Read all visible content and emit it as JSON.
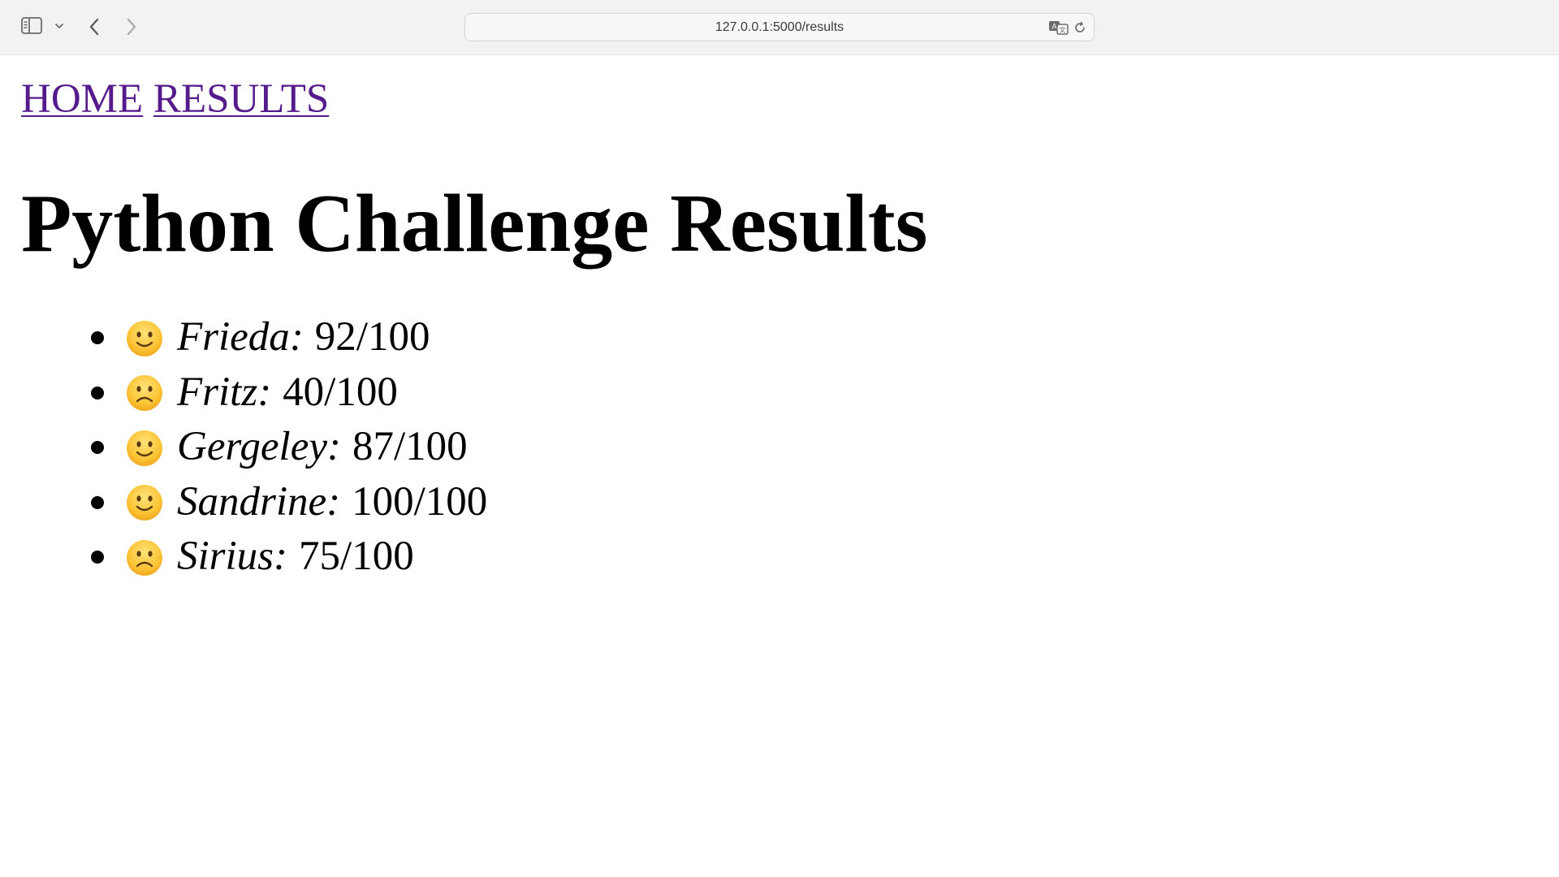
{
  "browser": {
    "url": "127.0.0.1:5000/results",
    "icons": {
      "sidebar": "sidebar-icon",
      "chevron": "chevron-down-icon",
      "back": "back-arrow-icon",
      "forward": "forward-arrow-icon",
      "translate": "translate-icon",
      "reload": "reload-icon"
    }
  },
  "nav": {
    "home_label": "HOME",
    "results_label": "RESULTS",
    "link_color": "#551a8b"
  },
  "page": {
    "title": "Python Challenge Results"
  },
  "results": [
    {
      "name": "Frieda",
      "separator": ":",
      "score": "92/100",
      "face": "smiley-face-icon"
    },
    {
      "name": "Fritz",
      "separator": ":",
      "score": "40/100",
      "face": "frowning-face-icon"
    },
    {
      "name": "Gergeley",
      "separator": ":",
      "score": "87/100",
      "face": "smiley-face-icon"
    },
    {
      "name": "Sandrine",
      "separator": ":",
      "score": "100/100",
      "face": "smiley-face-icon"
    },
    {
      "name": "Sirius",
      "separator": ":",
      "score": "75/100",
      "face": "frowning-face-icon"
    }
  ]
}
